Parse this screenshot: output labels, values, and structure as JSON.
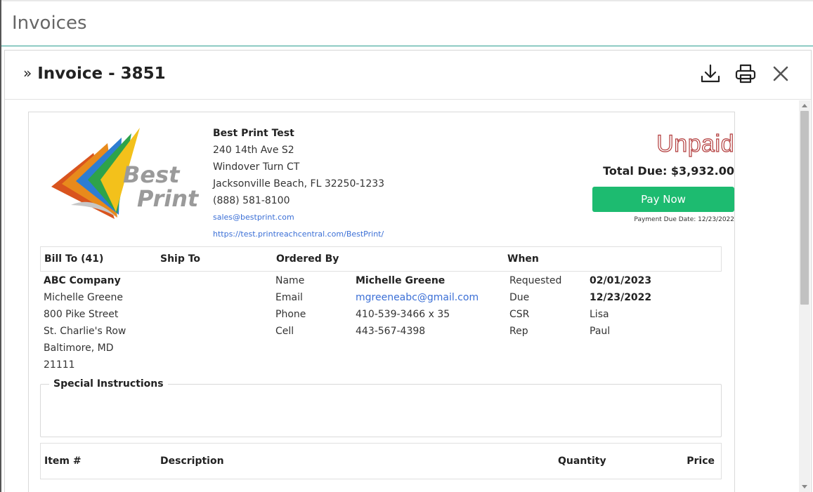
{
  "page": {
    "title": "Invoices"
  },
  "panel": {
    "title": "Invoice - 3851",
    "chevron": "»",
    "actions": [
      {
        "name": "download-icon"
      },
      {
        "name": "printer-icon"
      },
      {
        "name": "close-icon"
      }
    ]
  },
  "company": {
    "name": "Best Print Test",
    "address1": "240 14th Ave S2",
    "address2": "Windover Turn CT",
    "city_state_zip": "Jacksonville Beach, FL 32250-1233",
    "phone": "(888) 581-8100",
    "email": "sales@bestprint.com",
    "website": "https://test.printreachcentral.com/BestPrint/",
    "logo_text_1": "Best",
    "logo_text_2": "Print"
  },
  "status": {
    "label": "Unpaid",
    "total_due": "Total Due: $3,932.00",
    "pay_button": "Pay Now",
    "payment_due": "Payment Due Date: 12/23/2022",
    "color": "#b23b3b",
    "pay_color": "#1dbb70"
  },
  "info_headers": {
    "bill_to": "Bill To (41)",
    "ship_to": "Ship To",
    "ordered_by": "Ordered By",
    "when": "When"
  },
  "bill_to": {
    "company": "ABC Company",
    "contact": "Michelle Greene",
    "street": "800 Pike Street",
    "street2": "St. Charlie's Row",
    "city_state": "Baltimore, MD",
    "zip": "21111"
  },
  "ordered_by": {
    "labels": {
      "name": "Name",
      "email": "Email",
      "phone": "Phone",
      "cell": "Cell"
    },
    "name": "Michelle Greene",
    "email": "mgreeneabc@gmail.com",
    "phone": "410-539-3466 x 35",
    "cell": "443-567-4398"
  },
  "when": {
    "labels": {
      "requested": "Requested",
      "due": "Due",
      "csr": "CSR",
      "rep": "Rep"
    },
    "requested": "02/01/2023",
    "due": "12/23/2022",
    "csr": "Lisa",
    "rep": "Paul"
  },
  "special_instructions": {
    "label": "Special Instructions",
    "text": ""
  },
  "items_table": {
    "columns": [
      "Item #",
      "Description",
      "Quantity",
      "Price"
    ]
  }
}
